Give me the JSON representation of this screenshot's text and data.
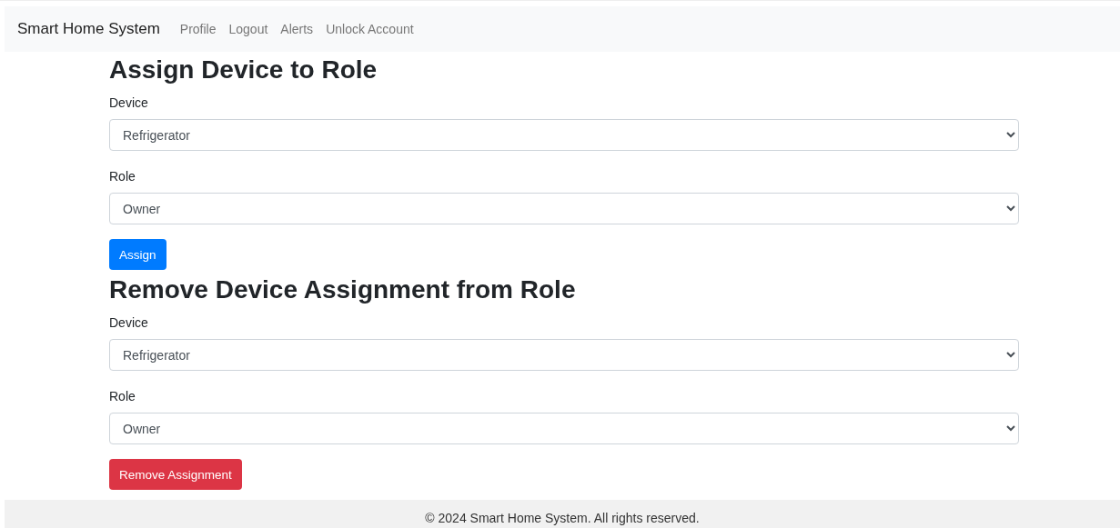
{
  "navbar": {
    "brand": "Smart Home System",
    "links": [
      "Profile",
      "Logout",
      "Alerts",
      "Unlock Account"
    ]
  },
  "forms": [
    {
      "title": "Assign Device to Role",
      "fields": [
        {
          "label": "Device",
          "value": "Refrigerator"
        },
        {
          "label": "Role",
          "value": "Owner"
        }
      ],
      "button": {
        "label": "Assign",
        "kind": "primary"
      }
    },
    {
      "title": "Remove Device Assignment from Role",
      "fields": [
        {
          "label": "Device",
          "value": "Refrigerator"
        },
        {
          "label": "Role",
          "value": "Owner"
        }
      ],
      "button": {
        "label": "Remove Assignment",
        "kind": "danger"
      }
    }
  ],
  "footer": "© 2024 Smart Home System. All rights reserved."
}
